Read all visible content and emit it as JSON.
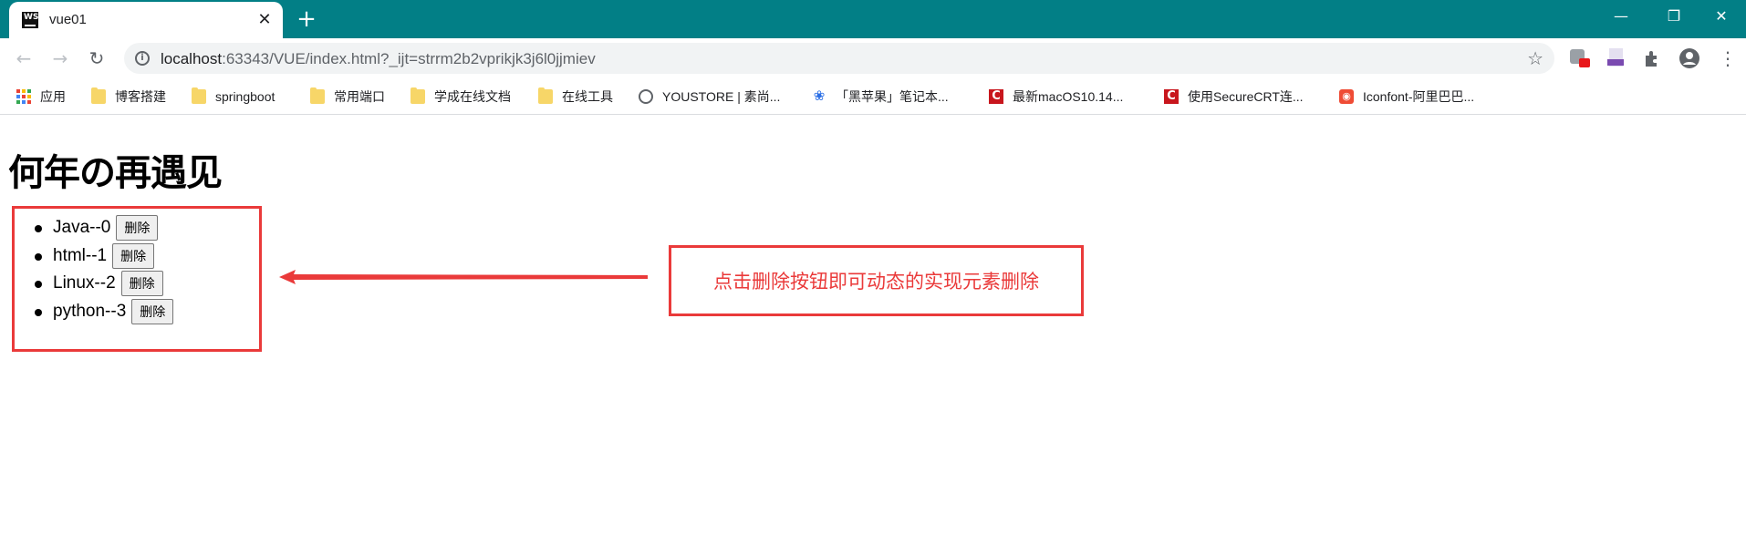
{
  "browser": {
    "tab_title": "vue01",
    "tab_favicon": "WS",
    "url_host": "localhost",
    "url_rest": ":63343/VUE/index.html?_ijt=strrm2b2vprikjk3j6l0jjmiev",
    "theme_color": "#027f86"
  },
  "bookmarks": [
    {
      "label": "应用",
      "icon": "apps-icon"
    },
    {
      "label": "博客搭建",
      "icon": "folder-icon"
    },
    {
      "label": "springboot",
      "icon": "folder-icon"
    },
    {
      "label": "常用端口",
      "icon": "folder-icon"
    },
    {
      "label": "学成在线文档",
      "icon": "folder-icon"
    },
    {
      "label": "在线工具",
      "icon": "folder-icon"
    },
    {
      "label": "YOUSTORE | 素尚...",
      "icon": "globe-icon"
    },
    {
      "label": "「黑苹果」笔记本...",
      "icon": "baidu-paw-icon"
    },
    {
      "label": "最新macOS10.14...",
      "icon": "csdn-icon"
    },
    {
      "label": "使用SecureCRT连...",
      "icon": "csdn-icon"
    },
    {
      "label": "Iconfont-阿里巴巴...",
      "icon": "iconfont-icon"
    }
  ],
  "page": {
    "heading": "何年の再遇见",
    "items": [
      {
        "label": "Java--0",
        "button": "删除"
      },
      {
        "label": "html--1",
        "button": "删除"
      },
      {
        "label": "Linux--2",
        "button": "删除"
      },
      {
        "label": "python--3",
        "button": "删除"
      }
    ],
    "annotation": "点击删除按钮即可动态的实现元素删除",
    "annotation_color": "#ea3a3a"
  }
}
